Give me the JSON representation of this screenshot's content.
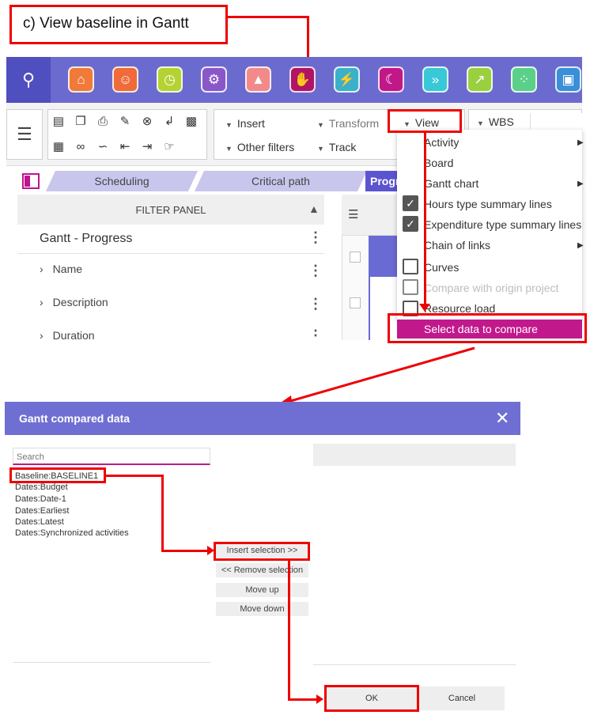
{
  "callout": {
    "title": "c) View baseline in Gantt"
  },
  "apps": [
    {
      "icon": "home-icon",
      "color": "#f07a3a",
      "glyph": "⌂"
    },
    {
      "icon": "users-icon",
      "color": "#f06a3a",
      "glyph": "☺"
    },
    {
      "icon": "timesheet-icon",
      "color": "#b4d232",
      "glyph": "◷"
    },
    {
      "icon": "gear-icon",
      "color": "#8a57c9",
      "glyph": "⚙"
    },
    {
      "icon": "graduation-cap-icon",
      "color": "#f28a8a",
      "glyph": "▲"
    },
    {
      "icon": "hand-money-icon",
      "color": "#b01464",
      "glyph": "✋"
    },
    {
      "icon": "folder-bolt-icon",
      "color": "#3cb0c8",
      "glyph": "⚡"
    },
    {
      "icon": "moon-icon",
      "color": "#c01888",
      "glyph": "☾"
    },
    {
      "icon": "arrows-icon",
      "color": "#38c8d8",
      "glyph": "»"
    },
    {
      "icon": "chart-sparkle-icon",
      "color": "#9ad040",
      "glyph": "↗"
    },
    {
      "icon": "grid-dots-icon",
      "color": "#5ad088",
      "glyph": "⁘"
    },
    {
      "icon": "briefcase-icon",
      "color": "#3a8fd8",
      "glyph": "▣"
    }
  ],
  "toolbar": {
    "insert": "Insert",
    "transform": "Transform",
    "view": "View",
    "wbs": "WBS",
    "other_filters": "Other filters",
    "track": "Track"
  },
  "tabs": {
    "scheduling": "Scheduling",
    "critical_path": "Critical path",
    "progress": "Progress"
  },
  "filter_panel": {
    "header": "FILTER PANEL",
    "view_name": "Gantt - Progress",
    "rows": [
      "Name",
      "Description",
      "Duration"
    ]
  },
  "view_menu": {
    "items": [
      {
        "label": "Activity",
        "submenu": true
      },
      {
        "label": "Board",
        "submenu": false
      },
      {
        "label": "Gantt chart",
        "submenu": true
      },
      {
        "label": "Hours type summary lines",
        "checked": true
      },
      {
        "label": "Expenditure type summary lines",
        "checked": true
      },
      {
        "label": "Chain of links",
        "submenu": true
      },
      {
        "label": "Curves",
        "checked": false
      },
      {
        "label": "Compare with origin project",
        "checked": false,
        "disabled": true
      },
      {
        "label": "Resource load",
        "checked": false
      }
    ],
    "highlighted": "Select data to compare"
  },
  "dialog": {
    "title": "Gantt compared data",
    "search_placeholder": "Search",
    "list": [
      "Baseline:BASELINE1",
      "Dates:Budget",
      "Dates:Date-1",
      "Dates:Earliest",
      "Dates:Latest",
      "Dates:Synchronized activities"
    ],
    "buttons": {
      "insert": "Insert selection >>",
      "remove": "<< Remove selection",
      "move_up": "Move up",
      "move_down": "Move down",
      "ok": "OK",
      "cancel": "Cancel"
    }
  },
  "colors": {
    "highlight": "#ee0000",
    "accent": "#c1188c",
    "header": "#6f6fd3"
  }
}
